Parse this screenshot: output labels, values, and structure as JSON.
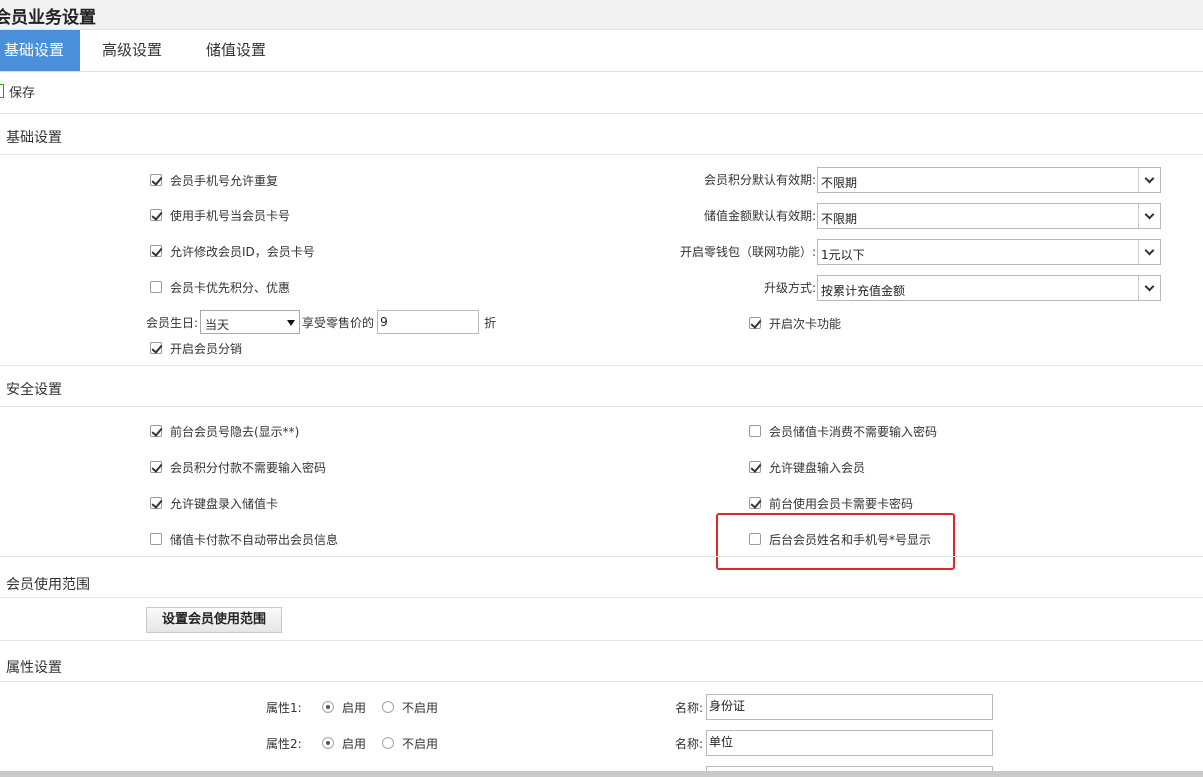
{
  "page_title": "会员业务设置",
  "tabs": [
    {
      "label": "基础设置",
      "active": true
    },
    {
      "label": "高级设置",
      "active": false
    },
    {
      "label": "储值设置",
      "active": false
    }
  ],
  "toolbar": {
    "save_label": "保存",
    "save_icon": "save-icon"
  },
  "sections": {
    "basic": "基础设置",
    "security": "安全设置",
    "scope": "会员使用范围",
    "attributes": "属性设置"
  },
  "basic": {
    "checkboxes": [
      {
        "label": "会员手机号允许重复",
        "checked": true
      },
      {
        "label": "使用手机号当会员卡号",
        "checked": true
      },
      {
        "label": "允许修改会员ID，会员卡号",
        "checked": true
      },
      {
        "label": "会员卡优先积分、优惠",
        "checked": false
      },
      {
        "label": "开启会员分销",
        "checked": true
      }
    ],
    "birthday": {
      "label": "会员生日:",
      "select_value": "当天",
      "mid_label": "享受零售价的",
      "discount_value": "9",
      "suffix": "折"
    },
    "selects": [
      {
        "label": "会员积分默认有效期:",
        "value": "不限期"
      },
      {
        "label": "储值金额默认有效期:",
        "value": "不限期"
      },
      {
        "label": "开启零钱包（联网功能）:",
        "value": "1元以下"
      },
      {
        "label": "升级方式:",
        "value": "按累计充值金额"
      }
    ],
    "right_checkbox": {
      "label": "开启次卡功能",
      "checked": true
    }
  },
  "security": {
    "left": [
      {
        "label": "前台会员号隐去(显示**)",
        "checked": true
      },
      {
        "label": "会员积分付款不需要输入密码",
        "checked": true
      },
      {
        "label": "允许键盘录入储值卡",
        "checked": true
      },
      {
        "label": "储值卡付款不自动带出会员信息",
        "checked": false
      }
    ],
    "right": [
      {
        "label": "会员储值卡消费不需要输入密码",
        "checked": false
      },
      {
        "label": "允许键盘输入会员",
        "checked": true
      },
      {
        "label": "前台使用会员卡需要卡密码",
        "checked": true
      },
      {
        "label": "后台会员姓名和手机号*号显示",
        "checked": false
      }
    ],
    "highlight_color": "#e0262a"
  },
  "scope": {
    "button_label": "设置会员使用范围"
  },
  "attributes": [
    {
      "label": "属性1:",
      "enable": "启用",
      "disable": "不启用",
      "enabled": true,
      "name_label": "名称:",
      "name_value": "身份证"
    },
    {
      "label": "属性2:",
      "enable": "启用",
      "disable": "不启用",
      "enabled": true,
      "name_label": "名称:",
      "name_value": "单位"
    }
  ],
  "colors": {
    "accent": "#4a8fd9",
    "save_icon": "#2da01a"
  }
}
